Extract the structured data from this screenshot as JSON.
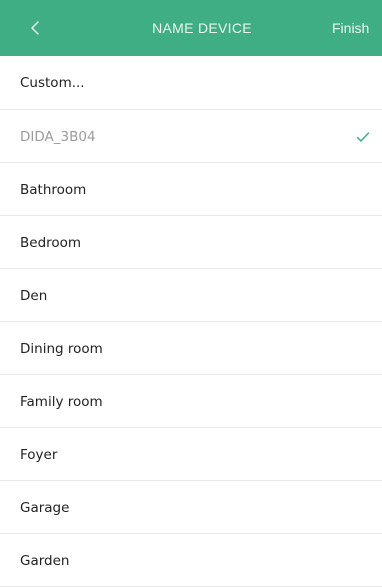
{
  "header": {
    "back_icon": "chevron-left-icon",
    "title": "NAME DEVICE",
    "finish_label": "Finish"
  },
  "options": {
    "custom_label": "Custom...",
    "current_name": "DIDA_3B04",
    "selected_icon": "check-icon",
    "rooms": [
      "Bathroom",
      "Bedroom",
      "Den",
      "Dining room",
      "Family room",
      "Foyer",
      "Garage",
      "Garden"
    ]
  },
  "colors": {
    "header_bg": "#3fae85",
    "header_text": "#e9f6f0",
    "accent_check": "#3fae85",
    "current_text": "#9c9c9c",
    "divider": "#e8e8e8"
  }
}
